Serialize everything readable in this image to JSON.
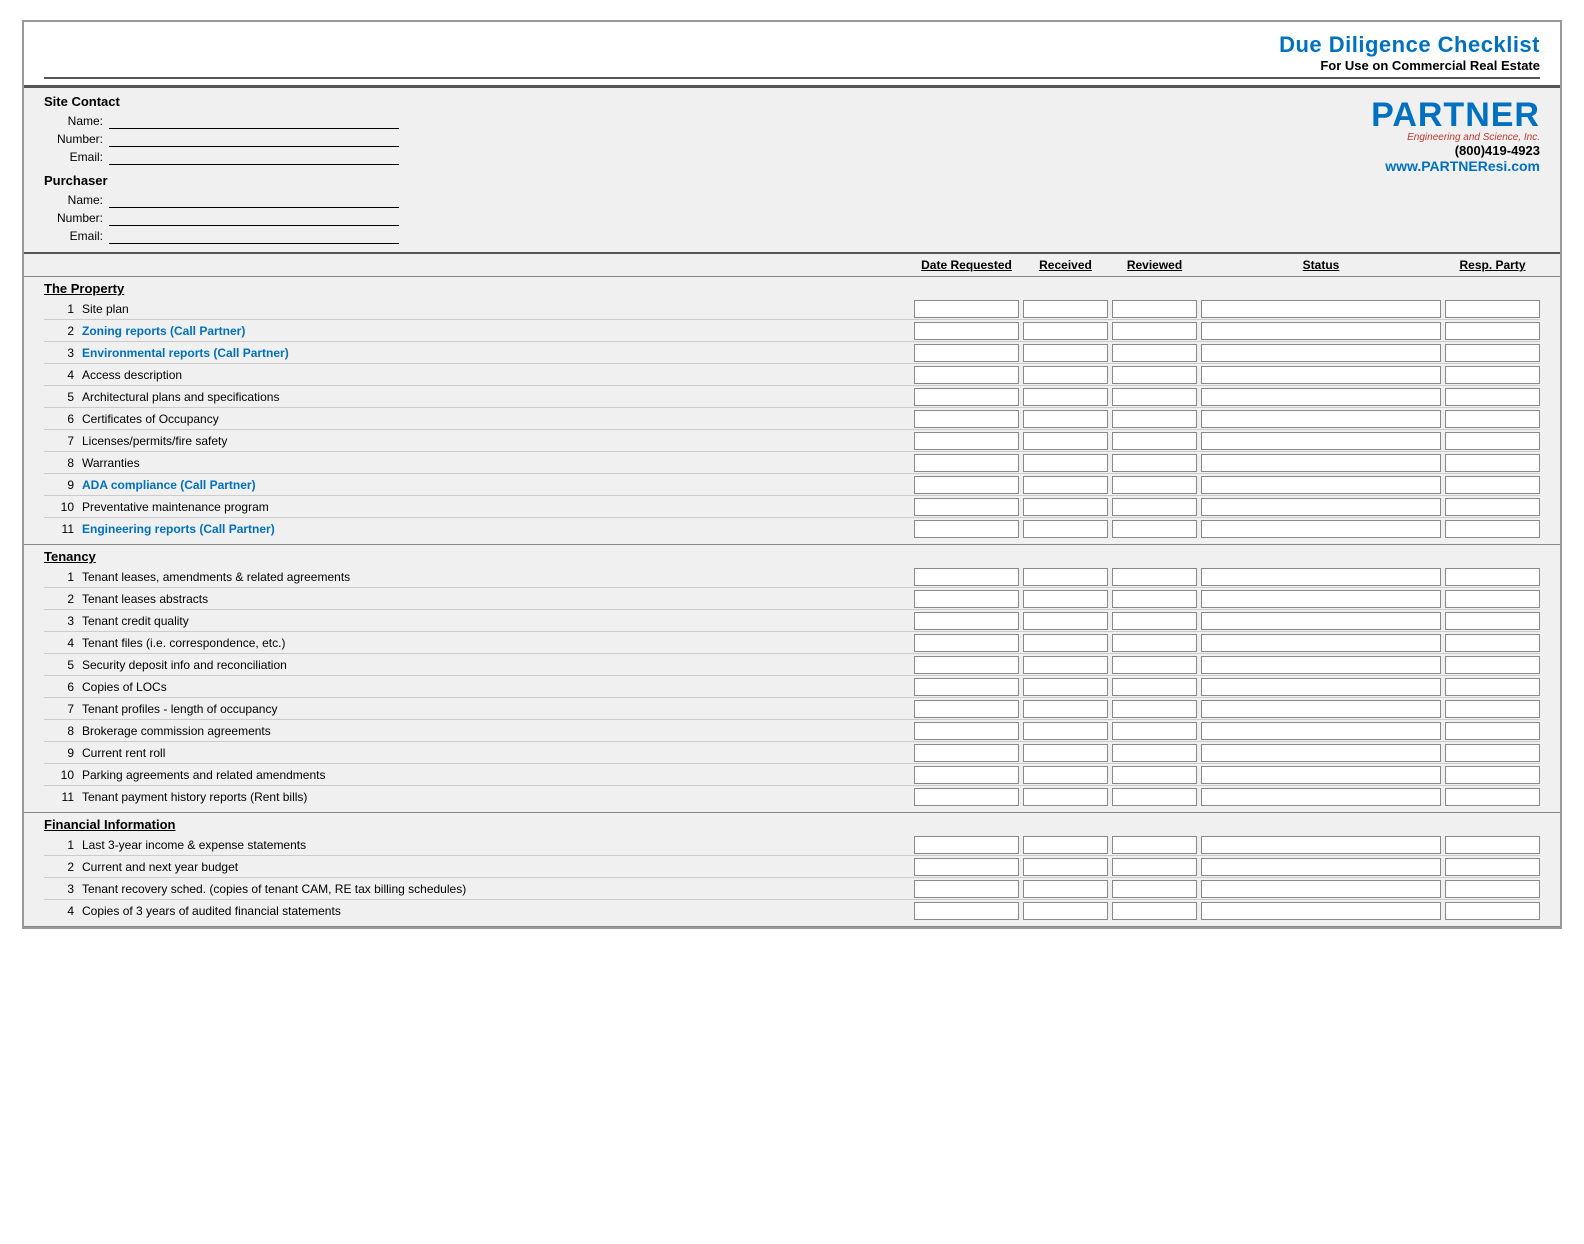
{
  "header": {
    "title": "Due Diligence Checklist",
    "subtitle": "For Use on Commercial Real Estate"
  },
  "partner": {
    "logo": "PARTNER",
    "tagline": "Engineering and Science, Inc.",
    "phone": "(800)419-4923",
    "website": "www.PARTNEResi.com"
  },
  "site_contact": {
    "heading": "Site Contact",
    "name_label": "Name:",
    "number_label": "Number:",
    "email_label": "Email:"
  },
  "purchaser": {
    "heading": "Purchaser",
    "name_label": "Name:",
    "number_label": "Number:",
    "email_label": "Email:"
  },
  "columns": {
    "date_requested": "Date Requested",
    "received": "Received",
    "reviewed": "Reviewed",
    "status": "Status",
    "resp_party": "Resp. Party"
  },
  "sections": [
    {
      "title": "The Property",
      "items": [
        {
          "num": 1,
          "label": "Site plan",
          "blue": false
        },
        {
          "num": 2,
          "label": "Zoning reports (Call Partner)",
          "blue": true
        },
        {
          "num": 3,
          "label": "Environmental reports (Call Partner)",
          "blue": true
        },
        {
          "num": 4,
          "label": "Access description",
          "blue": false
        },
        {
          "num": 5,
          "label": "Architectural plans and specifications",
          "blue": false
        },
        {
          "num": 6,
          "label": "Certificates of Occupancy",
          "blue": false
        },
        {
          "num": 7,
          "label": "Licenses/permits/fire safety",
          "blue": false
        },
        {
          "num": 8,
          "label": "Warranties",
          "blue": false
        },
        {
          "num": 9,
          "label": "ADA compliance (Call Partner)",
          "blue": true
        },
        {
          "num": 10,
          "label": "Preventative maintenance program",
          "blue": false
        },
        {
          "num": 11,
          "label": "Engineering reports (Call Partner)",
          "blue": true
        }
      ]
    },
    {
      "title": "Tenancy",
      "items": [
        {
          "num": 1,
          "label": "Tenant leases, amendments & related agreements",
          "blue": false
        },
        {
          "num": 2,
          "label": "Tenant leases abstracts",
          "blue": false
        },
        {
          "num": 3,
          "label": "Tenant credit quality",
          "blue": false
        },
        {
          "num": 4,
          "label": "Tenant files (i.e. correspondence, etc.)",
          "blue": false
        },
        {
          "num": 5,
          "label": "Security deposit info and reconciliation",
          "blue": false
        },
        {
          "num": 6,
          "label": "Copies of LOCs",
          "blue": false
        },
        {
          "num": 7,
          "label": "Tenant profiles - length of occupancy",
          "blue": false
        },
        {
          "num": 8,
          "label": "Brokerage commission agreements",
          "blue": false
        },
        {
          "num": 9,
          "label": "Current rent roll",
          "blue": false
        },
        {
          "num": 10,
          "label": "Parking agreements and related amendments",
          "blue": false
        },
        {
          "num": 11,
          "label": "Tenant payment history reports (Rent bills)",
          "blue": false
        }
      ]
    },
    {
      "title": "Financial Information",
      "items": [
        {
          "num": 1,
          "label": "Last 3-year income & expense statements",
          "blue": false
        },
        {
          "num": 2,
          "label": "Current and next year budget",
          "blue": false
        },
        {
          "num": 3,
          "label": "Tenant recovery sched. (copies of tenant CAM, RE tax billing schedules)",
          "blue": false,
          "multiline": true
        },
        {
          "num": 4,
          "label": "Copies of 3 years of audited financial statements",
          "blue": false
        }
      ]
    }
  ]
}
